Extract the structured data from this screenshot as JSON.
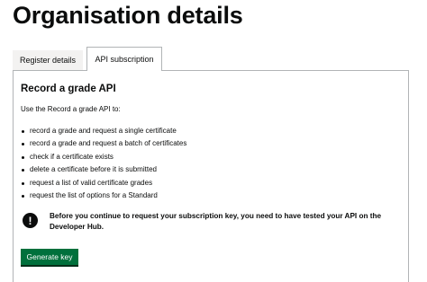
{
  "page": {
    "title": "Organisation details"
  },
  "tabs": [
    {
      "label": "Register details",
      "selected": false
    },
    {
      "label": "API subscription",
      "selected": true
    }
  ],
  "panel": {
    "heading": "Record a grade API",
    "intro": "Use the Record a grade API to:",
    "items": [
      "record a grade and request a single certificate",
      "record a grade and request a batch of certificates",
      "check if a certificate exists",
      "delete a certificate before it is submitted",
      "request a list of valid certificate grades",
      "request the list of options for a Standard"
    ],
    "warning": {
      "icon": "exclamation-icon",
      "icon_glyph": "!",
      "text": "Before you continue to request your subscription key, you need to have tested your API on the Developer Hub."
    },
    "button_label": "Generate key"
  },
  "colors": {
    "button_green": "#00703c",
    "text": "#0b0c0c",
    "border": "#b1b4b6",
    "inactive_tab": "#f3f2f1"
  }
}
